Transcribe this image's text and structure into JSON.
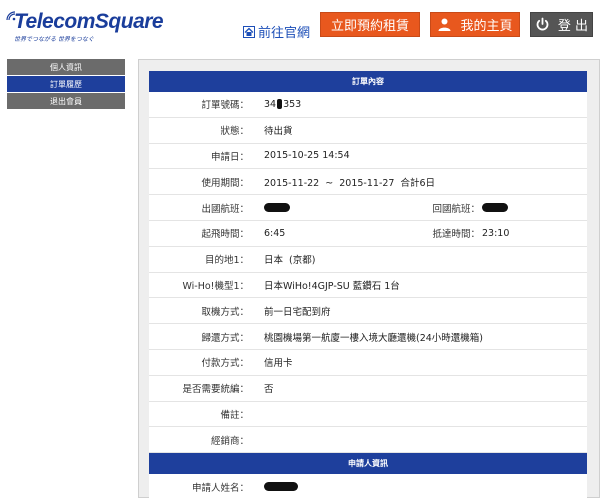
{
  "header": {
    "logo_text": "TelecomSquare",
    "logo_tagline": "世界でつながる 世界をつなぐ",
    "home_link": "前往官網",
    "reserve_button": "立即預約租賃",
    "mypage_button": "我的主頁",
    "logout_button": "登 出"
  },
  "sidebar": {
    "items": [
      {
        "label": "個人資訊"
      },
      {
        "label": "訂單履歷"
      },
      {
        "label": "退出會員"
      }
    ]
  },
  "order_section": {
    "title": "訂單內容",
    "rows": [
      {
        "label": "訂單號碼：",
        "value_prefix": "34",
        "value_suffix": "353"
      },
      {
        "label": "狀態：",
        "value": "待出貨"
      },
      {
        "label": "申請日：",
        "value": "2015-10-25 14:54"
      },
      {
        "label": "使用期間：",
        "value": "2015-11-22  ~  2015-11-27  合計6日"
      },
      {
        "label": "出國航班：",
        "value": "",
        "label2": "回國航班：",
        "value2": ""
      },
      {
        "label": "起飛時間：",
        "value": "6:45",
        "label2": "抵達時間：",
        "value2": "23:10"
      },
      {
        "label": "目的地1：",
        "value": "日本  (京都)"
      },
      {
        "label": "Wi-Ho!機型1：",
        "value": "日本WiHo!4GJP-SU 藍鑽石 1台"
      },
      {
        "label": "取機方式：",
        "value": "前一日宅配到府"
      },
      {
        "label": "歸還方式：",
        "value": "桃園機場第一航廈一樓入境大廳還機(24小時還機箱)"
      },
      {
        "label": "付款方式：",
        "value": "信用卡"
      },
      {
        "label": "是否需要統編：",
        "value": "否"
      },
      {
        "label": "備註：",
        "value": ""
      },
      {
        "label": "經銷商：",
        "value": ""
      }
    ]
  },
  "applicant_section": {
    "title": "申請人資訊",
    "rows": [
      {
        "label": "申請人姓名：",
        "value": ""
      }
    ]
  },
  "colors": {
    "brand_blue": "#1e3f9c",
    "accent_orange": "#e8581e",
    "logout_gray": "#555555"
  },
  "icons": {
    "home": "home-icon",
    "mypage": "user-icon",
    "logout": "power-icon"
  }
}
